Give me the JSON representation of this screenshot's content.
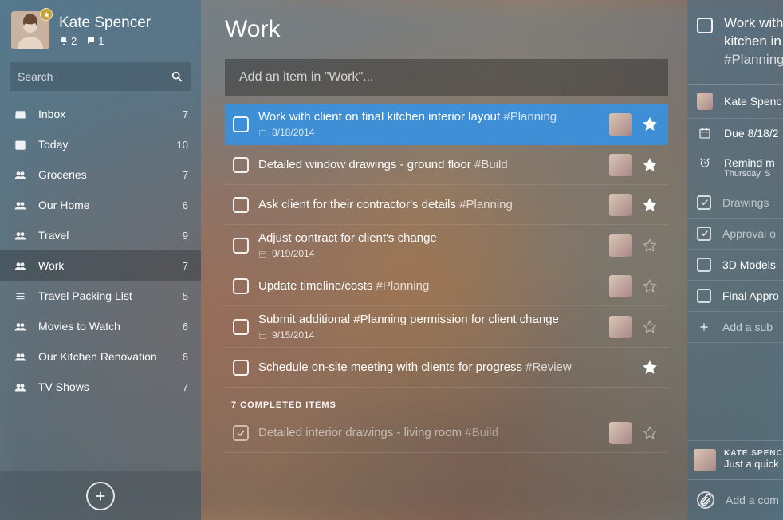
{
  "user": {
    "name": "Kate Spencer",
    "notifications": "2",
    "comments": "1"
  },
  "search": {
    "placeholder": "Search"
  },
  "sidebar": {
    "items": [
      {
        "icon": "inbox",
        "label": "Inbox",
        "count": "7"
      },
      {
        "icon": "today",
        "label": "Today",
        "count": "10"
      },
      {
        "icon": "people",
        "label": "Groceries",
        "count": "7"
      },
      {
        "icon": "people",
        "label": "Our Home",
        "count": "6"
      },
      {
        "icon": "people",
        "label": "Travel",
        "count": "9"
      },
      {
        "icon": "people",
        "label": "Work",
        "count": "7"
      },
      {
        "icon": "list",
        "label": "Travel Packing List",
        "count": "5"
      },
      {
        "icon": "people",
        "label": "Movies to Watch",
        "count": "6"
      },
      {
        "icon": "people",
        "label": "Our Kitchen Renovation",
        "count": "6"
      },
      {
        "icon": "people",
        "label": "TV Shows",
        "count": "7"
      }
    ],
    "active_index": 5
  },
  "main": {
    "title": "Work",
    "add_placeholder": "Add an item in \"Work\"...",
    "tasks": [
      {
        "title": "Work with client on final kitchen interior layout",
        "tag": "#Planning",
        "date": "8/18/2014",
        "starred": true,
        "selected": true,
        "has_avatar": true
      },
      {
        "title": "Detailed window drawings - ground floor",
        "tag": "#Build",
        "date": "",
        "starred": true,
        "selected": false,
        "has_avatar": true
      },
      {
        "title": "Ask client for their contractor's details",
        "tag": "#Planning",
        "date": "",
        "starred": true,
        "selected": false,
        "has_avatar": true
      },
      {
        "title": "Adjust contract for client's change",
        "tag": "",
        "date": "9/19/2014",
        "starred": false,
        "selected": false,
        "has_avatar": true
      },
      {
        "title": "Update timeline/costs",
        "tag": "#Planning",
        "date": "",
        "starred": false,
        "selected": false,
        "has_avatar": true
      },
      {
        "title": "Submit additional #Planning permission for client change",
        "tag": "",
        "date": "9/15/2014",
        "starred": false,
        "selected": false,
        "has_avatar": true
      },
      {
        "title": "Schedule on-site meeting with clients for progress",
        "tag": "#Review",
        "date": "",
        "starred": true,
        "selected": false,
        "has_avatar": false
      }
    ],
    "completed_header": "7 COMPLETED ITEMS",
    "completed": [
      {
        "title": "Detailed interior drawings - living room",
        "tag": "#Build",
        "has_avatar": true
      }
    ]
  },
  "detail": {
    "title_l1": "Work with",
    "title_l2": "kitchen in",
    "title_l3": "#Planning",
    "assigned": "Kate Spenc",
    "due": "Due 8/18/2",
    "remind_l1": "Remind m",
    "remind_l2": "Thursday, S",
    "subtasks": [
      {
        "done": true,
        "label": "Drawings"
      },
      {
        "done": true,
        "label": "Approval o"
      },
      {
        "done": false,
        "label": "3D Models"
      },
      {
        "done": false,
        "label": "Final Appro"
      }
    ],
    "add_subtask": "Add a sub",
    "comment": {
      "name": "KATE SPENCE",
      "text": "Just a quick"
    },
    "add_comment": "Add a com"
  }
}
